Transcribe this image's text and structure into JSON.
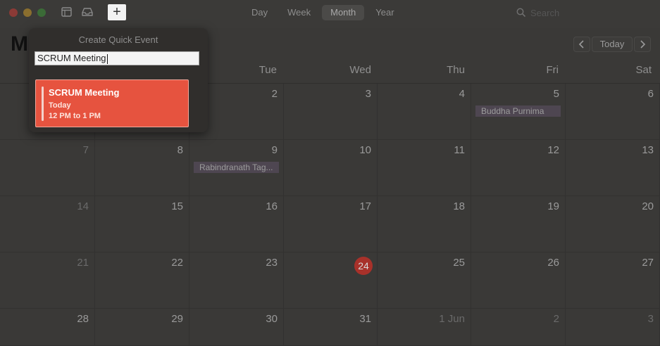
{
  "toolbar": {
    "add_label": "+",
    "views": [
      {
        "label": "Day",
        "active": false
      },
      {
        "label": "Week",
        "active": false
      },
      {
        "label": "Month",
        "active": true
      },
      {
        "label": "Year",
        "active": false
      }
    ],
    "search_placeholder": "Search"
  },
  "header": {
    "month_initial": "M",
    "today_label": "Today",
    "prev_icon": "chevron-left-icon",
    "next_icon": "chevron-right-icon"
  },
  "weekdays": [
    "Tue",
    "Wed",
    "Thu",
    "Fri",
    "Sat"
  ],
  "weeks": [
    [
      "",
      "",
      "2",
      "3",
      "4",
      "5",
      "6"
    ],
    [
      "7",
      "8",
      "9",
      "10",
      "11",
      "12",
      "13"
    ],
    [
      "14",
      "15",
      "16",
      "17",
      "18",
      "19",
      "20"
    ],
    [
      "21",
      "22",
      "23",
      "24",
      "25",
      "26",
      "27"
    ],
    [
      "28",
      "29",
      "30",
      "31",
      "1 Jun",
      "2",
      "3"
    ]
  ],
  "today": "24",
  "holidays": {
    "fri_5": "Buddha Purnima",
    "tue_9": "Rabindranath Tag..."
  },
  "quick_event": {
    "title": "Create Quick Event",
    "input_value": "SCRUM Meeting",
    "event_title": "SCRUM Meeting",
    "event_day": "Today",
    "event_time": "12 PM to 1 PM",
    "event_color": "#e6533f"
  }
}
